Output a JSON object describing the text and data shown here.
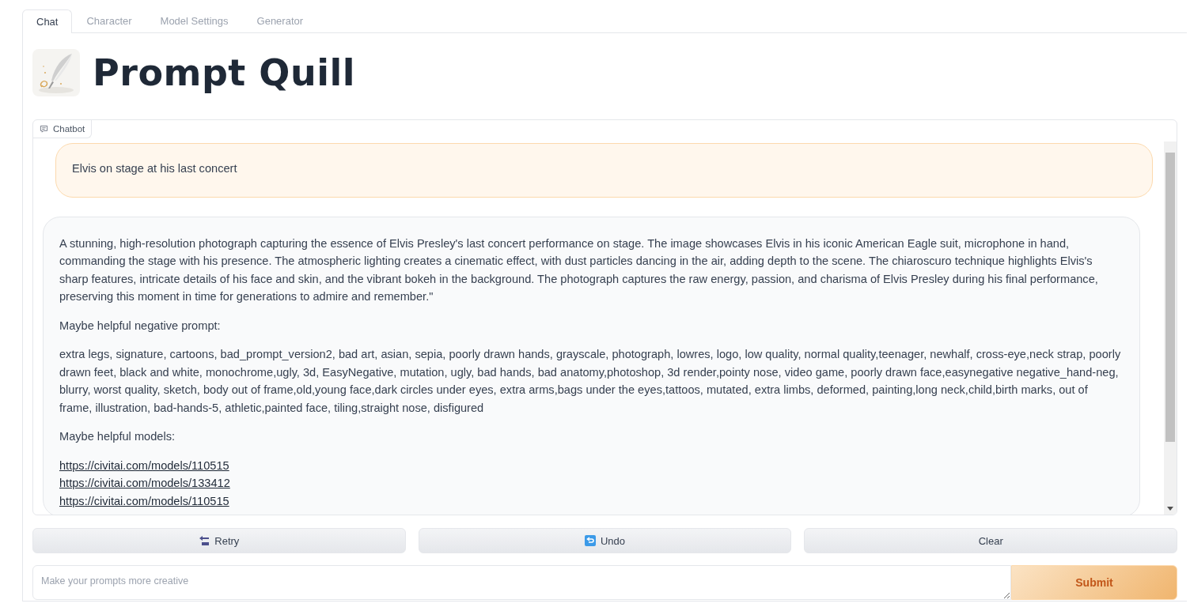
{
  "tabs": [
    {
      "label": "Chat",
      "selected": true
    },
    {
      "label": "Character",
      "selected": false
    },
    {
      "label": "Model Settings",
      "selected": false
    },
    {
      "label": "Generator",
      "selected": false
    }
  ],
  "header": {
    "title": "Prompt Quill"
  },
  "chatbot": {
    "label": "Chatbot",
    "messages": [
      {
        "kind": "user",
        "blocks": [
          {
            "kind": "text",
            "text": "Elvis on stage at his last concert"
          }
        ]
      },
      {
        "kind": "bot",
        "blocks": [
          {
            "kind": "text",
            "text": "A stunning, high-resolution photograph capturing the essence of Elvis Presley's last concert performance on stage. The image showcases Elvis in his iconic American Eagle suit, microphone in hand, commanding the stage with his presence. The atmospheric lighting creates a cinematic effect, with dust particles dancing in the air, adding depth to the scene. The chiaroscuro technique highlights Elvis's sharp features, intricate details of his face and skin, and the vibrant bokeh in the background. The photograph captures the raw energy, passion, and charisma of Elvis Presley during his final performance, preserving this moment in time for generations to admire and remember.\""
          },
          {
            "kind": "text",
            "text": "Maybe helpful negative prompt:"
          },
          {
            "kind": "text",
            "text": "extra legs, signature, cartoons, bad_prompt_version2, bad art, asian, sepia, poorly drawn hands, grayscale, photograph, lowres, logo, low quality, normal quality,teenager, newhalf, cross-eye,neck strap, poorly drawn feet, black and white, monochrome,ugly, 3d, EasyNegative, mutation, ugly, bad hands, bad anatomy,photoshop, 3d render,pointy nose, video game, poorly drawn face,easynegative negative_hand-neg, blurry, worst quality, sketch, body out of frame,old,young face,dark circles under eyes, extra arms,bags under the eyes,tattoos, mutated, extra limbs, deformed, painting,long neck,child,birth marks, out of frame, illustration, bad-hands-5, athletic,painted face, tiling,straight nose, disfigured"
          },
          {
            "kind": "text",
            "text": "Maybe helpful models:"
          },
          {
            "kind": "links",
            "links": [
              "https://civitai.com/models/110515",
              "https://civitai.com/models/133412",
              "https://civitai.com/models/110515"
            ]
          }
        ]
      }
    ]
  },
  "buttons": [
    {
      "label": "Retry",
      "kind": "back"
    },
    {
      "label": "Undo",
      "kind": "undo"
    },
    {
      "label": "Clear",
      "kind": "plain"
    }
  ],
  "input": {
    "placeholder": "Make your prompts more creative"
  },
  "submit": {
    "label": "Submit"
  }
}
